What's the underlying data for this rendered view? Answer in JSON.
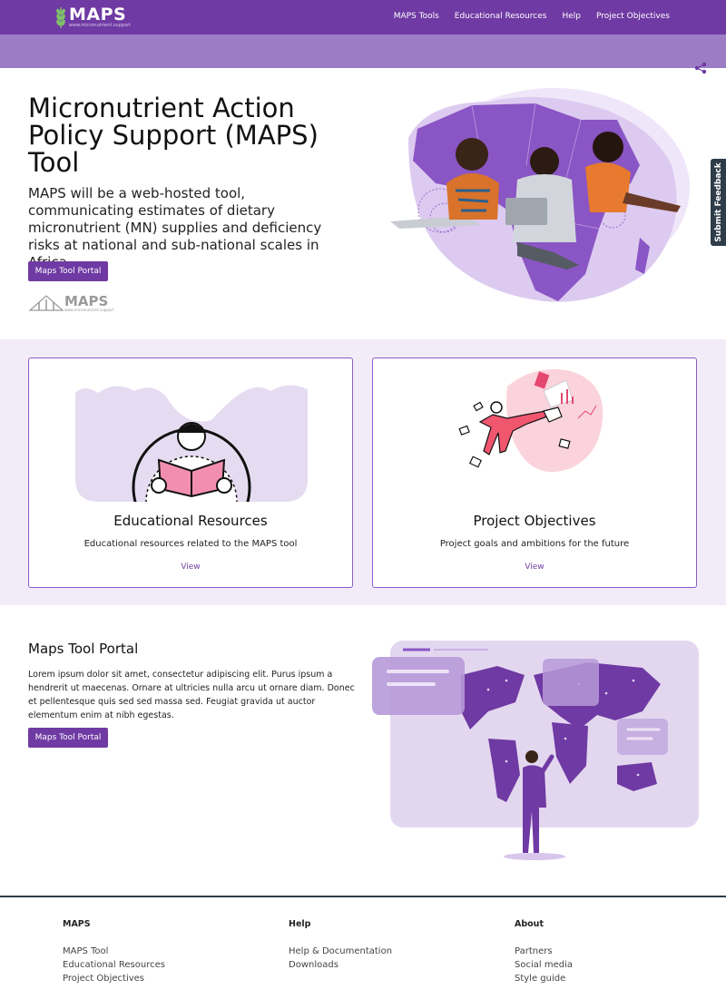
{
  "nav": {
    "brand": "MAPS",
    "site": "www.micronutrient.support",
    "links": [
      "MAPS Tools",
      "Educational Resources",
      "Help",
      "Project Objectives"
    ]
  },
  "feedback": "Submit Feedback",
  "hero": {
    "title": "Micronutrient Action Policy Support (MAPS) Tool",
    "text": "MAPS will be a web-hosted tool, communicating estimates of dietary micronutrient (MN) supplies and deficiency risks at national and sub-national scales in Africa.",
    "button": "Maps Tool Portal",
    "mini_logo": "MAPS",
    "mini_site": "www.micronutrient.support"
  },
  "cards": [
    {
      "title": "Educational Resources",
      "desc": "Educational resources related to the MAPS tool",
      "link": "View"
    },
    {
      "title": "Project Objectives",
      "desc": "Project goals and ambitions for the future",
      "link": "View"
    }
  ],
  "portal": {
    "title": "Maps Tool Portal",
    "text": "Lorem ipsum dolor sit amet, consectetur adipiscing elit. Purus ipsum a hendrerit ut maecenas. Ornare at ultricies nulla arcu ut ornare diam. Donec et pellentesque quis sed sed massa sed. Feugiat gravida ut auctor elementum enim at nibh egestas.",
    "button": "Maps Tool Portal"
  },
  "footer": {
    "cols": [
      {
        "head": "MAPS",
        "items": [
          "MAPS Tool",
          "Educational Resources",
          "Project Objectives"
        ]
      },
      {
        "head": "Help",
        "items": [
          "Help & Documentation",
          "Downloads"
        ]
      },
      {
        "head": "About",
        "items": [
          "Partners",
          "Social media",
          "Style guide"
        ]
      }
    ]
  },
  "colors": {
    "primary": "#6f3aa3",
    "band": "#9d7cc6",
    "cards_bg": "#f2ecf8",
    "feedback": "#2f3d4a"
  }
}
